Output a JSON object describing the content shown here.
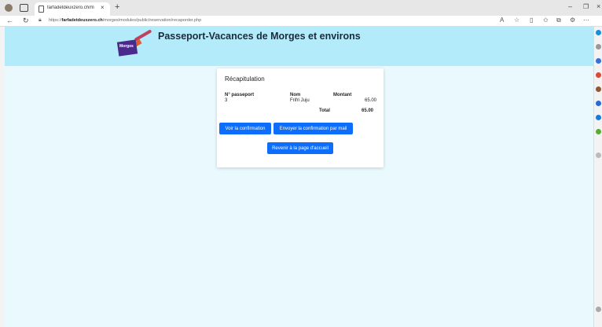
{
  "browser": {
    "tab_title": "farfadetdeuxzero.ch/morges/mo",
    "tab_close": "×",
    "new_tab": "+",
    "url_prefix": "https://",
    "url_domain": "farfadetdeuxzero.ch",
    "url_path": "/morges/modules/public/reservation/recaporder.php",
    "window_controls": {
      "minimize": "–",
      "restore": "❐",
      "close": "×"
    },
    "toolbar_icons": [
      "read-aloud-icon",
      "favorite-star-icon",
      "split-screen-icon",
      "favorites-icon",
      "collections-icon",
      "extensions-icon",
      "more-icon"
    ]
  },
  "header": {
    "title": "Passeport-Vacances de Morges et environs",
    "logo_text": "Morges"
  },
  "summary": {
    "title": "Récapitulation",
    "columns": [
      "N° passeport",
      "Nom",
      "Montant"
    ],
    "rows": [
      {
        "passport": "3",
        "name": "Frifri Juju",
        "amount": "65.00"
      }
    ],
    "total_label": "Total",
    "total_value": "65.00"
  },
  "buttons": {
    "view_confirmation": "Voir la confirmation",
    "send_confirmation": "Envoyer la confirmation par mail",
    "back_home": "Revenir à la page d'accueil"
  },
  "colors": {
    "header_bg": "#b3ebfa",
    "page_bg": "#eaf9fe",
    "button_bg": "#0d6efd"
  }
}
